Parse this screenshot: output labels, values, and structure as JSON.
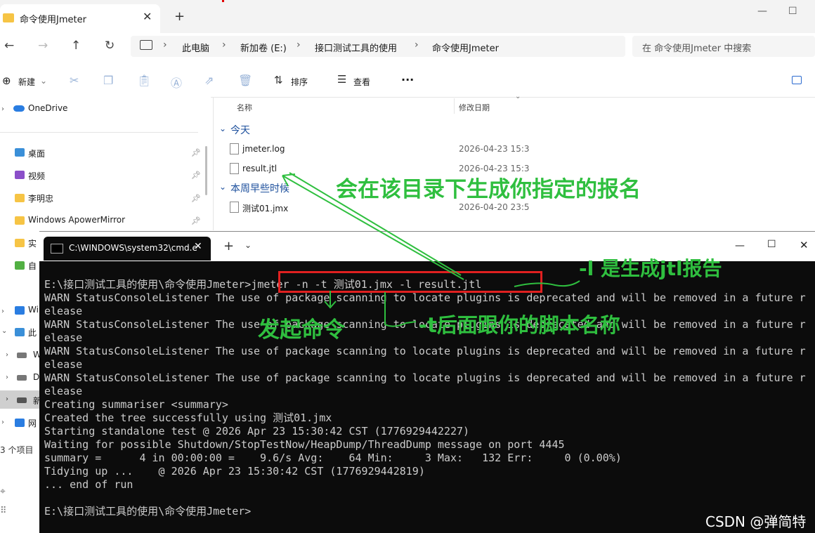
{
  "explorer": {
    "tab_title": "命令使用Jmeter",
    "breadcrumb": [
      "此电脑",
      "新加卷 (E:)",
      "接口测试工具的使用",
      "命令使用Jmeter"
    ],
    "search_placeholder": "在 命令使用Jmeter 中搜索",
    "toolbar": {
      "new": "新建",
      "sort": "排序",
      "view": "查看",
      "more": "···"
    },
    "sidebar": {
      "onedrive": "OneDrive",
      "items": [
        "桌面",
        "视频",
        "李明忠",
        "Windows ApowerMirror",
        "实",
        "自"
      ],
      "lower": [
        "Wi",
        "此",
        "W",
        "D",
        "新",
        "网"
      ],
      "status": "3 个项目"
    },
    "columns": {
      "name": "名称",
      "date": "修改日期"
    },
    "groups": {
      "today": "今天",
      "week": "本周早些时候"
    },
    "files": [
      {
        "name": "jmeter.log",
        "date": "2026-04-23 15:3"
      },
      {
        "name": "result.jtl",
        "date": "2026-04-23 15:3"
      },
      {
        "name": "测试01.jmx",
        "date": "2026-04-20 23:5"
      }
    ]
  },
  "cmd": {
    "tab_title": "C:\\WINDOWS\\system32\\cmd.e",
    "lines": [
      "E:\\接口测试工具的使用\\命令使用Jmeter>jmeter -n -t 测试01.jmx -l result.jtl",
      "WARN StatusConsoleListener The use of package scanning to locate plugins is deprecated and will be removed in a future r",
      "elease",
      "WARN StatusConsoleListener The use of package scanning to locate plugins is deprecated and will be removed in a future r",
      "elease",
      "WARN StatusConsoleListener The use of package scanning to locate plugins is deprecated and will be removed in a future r",
      "elease",
      "WARN StatusConsoleListener The use of package scanning to locate plugins is deprecated and will be removed in a future r",
      "elease",
      "Creating summariser <summary>",
      "Created the tree successfully using 测试01.jmx",
      "Starting standalone test @ 2026 Apr 23 15:30:42 CST (1776929442227)",
      "Waiting for possible Shutdown/StopTestNow/HeapDump/ThreadDump message on port 4445",
      "summary =      4 in 00:00:00 =    9.6/s Avg:    64 Min:     3 Max:   132 Err:     0 (0.00%)",
      "Tidying up ...    @ 2026 Apr 23 15:30:42 CST (1776929442819)",
      "... end of run",
      "",
      "E:\\接口测试工具的使用\\命令使用Jmeter>"
    ]
  },
  "annotations": {
    "report_dir": "会在该目录下生成你指定的报名",
    "l_flag": "-l 是生成jtl报告",
    "launch": "发起命令",
    "t_flag": "-t后面跟你的脚本名称"
  },
  "watermark": "CSDN @弹简特",
  "colors": {
    "annotation": "#2fbf3f",
    "highlight_box": "#e02020",
    "terminal_bg": "#0c0c0c"
  }
}
